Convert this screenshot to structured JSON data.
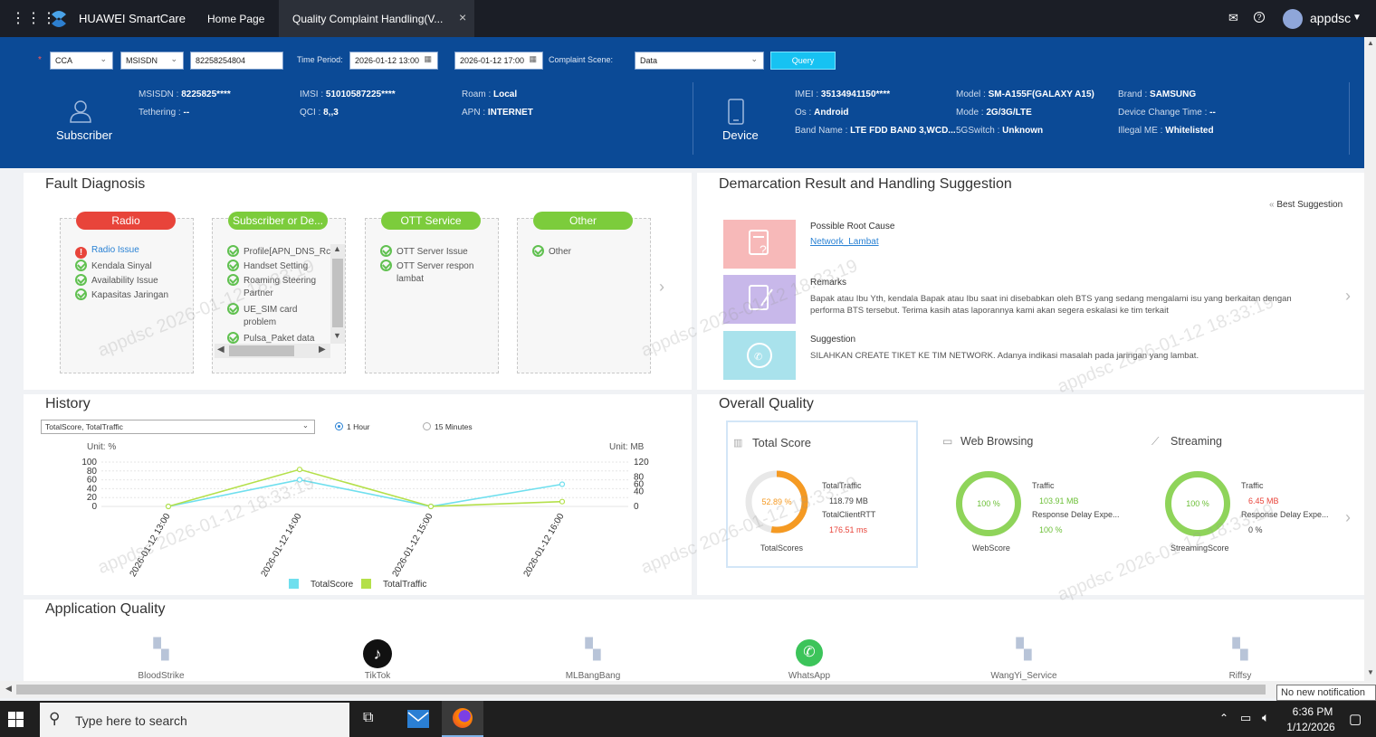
{
  "topbar": {
    "brand": "HUAWEI SmartCare",
    "tabs": [
      "Home Page",
      "Quality Complaint Handling(V..."
    ],
    "close": "×",
    "user": "appdsc"
  },
  "query": {
    "type": "CCA",
    "id_type": "MSISDN",
    "msisdn": "82258254804",
    "time_period_label": "Time Period:",
    "start": "2026-01-12 13:00",
    "end": "2026-01-12 17:00",
    "scene_label": "Complaint Scene:",
    "scene": "Data",
    "query_btn": "Query"
  },
  "subscriber": {
    "label": "Subscriber",
    "msisdn_k": "MSISDN",
    "msisdn_v": "8225825****",
    "imsi_k": "IMSI",
    "imsi_v": "51010587225****",
    "roam_k": "Roam",
    "roam_v": "Local",
    "tethering_k": "Tethering",
    "tethering_v": "--",
    "qci_k": "QCI",
    "qci_v": "8,,3",
    "apn_k": "APN",
    "apn_v": "INTERNET"
  },
  "device": {
    "label": "Device",
    "imei_k": "IMEI",
    "imei_v": "35134941150****",
    "model_k": "Model",
    "model_v": "SM-A155F(GALAXY A15)",
    "brand_k": "Brand",
    "brand_v": "SAMSUNG",
    "os_k": "Os",
    "os_v": "Android",
    "mode_k": "Mode",
    "mode_v": "2G/3G/LTE",
    "dct_k": "Device Change Time",
    "dct_v": "--",
    "band_k": "Band Name",
    "band_v": "LTE FDD BAND 3,WCD...",
    "sg_k": "5GSwitch",
    "sg_v": "Unknown",
    "ill_k": "Illegal ME",
    "ill_v": "Whitelisted"
  },
  "fault": {
    "title": "Fault Diagnosis",
    "columns": [
      {
        "name": "Radio",
        "color": "#e8443a",
        "items": [
          "Radio Issue",
          "Kendala Sinyal",
          "Availability Issue",
          "Kapasitas Jaringan"
        ]
      },
      {
        "name": "Subscriber or De...",
        "color": "#7ccc3c",
        "items": [
          "Profile[APN_DNS_Rc",
          "Handset Setting",
          "Roaming Steering",
          "Partner",
          "UE_SIM card",
          "problem",
          "Pulsa_Paket data"
        ]
      },
      {
        "name": "OTT Service",
        "color": "#7ccc3c",
        "items": [
          "OTT Server Issue",
          "OTT Server respon",
          "lambat"
        ]
      },
      {
        "name": "Other",
        "color": "#7ccc3c",
        "items": [
          "Other"
        ]
      }
    ]
  },
  "demarcation": {
    "title": "Demarcation Result and Handling Suggestion",
    "best": "Best Suggestion",
    "root_label": "Possible Root Cause",
    "root_link": "Network_Lambat",
    "remarks_label": "Remarks",
    "remarks_1": "Bapak atau Ibu Yth, kendala Bapak atau Ibu saat ini disebabkan oleh BTS yang sedang mengalami isu yang berkaitan dengan",
    "remarks_2": "performa BTS tersebut. Terima kasih atas laporannya kami akan segera eskalasi ke tim terkait",
    "sugg_label": "Suggestion",
    "sugg_text": "SILAHKAN CREATE TIKET KE TIM NETWORK. Adanya indikasi masalah pada jaringan yang lambat."
  },
  "history": {
    "title": "History",
    "select": "TotalScore, TotalTraffic",
    "radio1": "1 Hour",
    "radio2": "15 Minutes",
    "unit_left": "Unit: %",
    "unit_right": "Unit: MB"
  },
  "chart_data": {
    "type": "line",
    "x": [
      "2026-01-12 13:00",
      "2026-01-12 14:00",
      "2026-01-12 15:00",
      "2026-01-12 16:00"
    ],
    "series": [
      {
        "name": "TotalScore",
        "color": "#6fdfee",
        "axis": "left",
        "values": [
          0,
          60,
          0,
          50
        ]
      },
      {
        "name": "TotalTraffic",
        "color": "#b4e04a",
        "axis": "right",
        "values": [
          0,
          100,
          0,
          13
        ]
      }
    ],
    "yleft_ticks": [
      0,
      20,
      40,
      60,
      80,
      100
    ],
    "yright_ticks": [
      0,
      40,
      60,
      80,
      120
    ],
    "ylim_left": [
      0,
      100
    ],
    "ylim_right": [
      0,
      120
    ],
    "legend": "bottom"
  },
  "overall": {
    "title": "Overall Quality",
    "total_title": "Total Score",
    "total_pct": "52.89 %",
    "total_pct_num": 52.89,
    "total_traffic_k": "TotalTraffic",
    "total_traffic_v": "118.79 MB",
    "total_rtt_k": "TotalClientRTT",
    "total_rtt_v": "176.51 ms",
    "total_caption": "TotalScores",
    "web_title": "Web Browsing",
    "web_pct": "100 %",
    "web_traffic_k": "Traffic",
    "web_traffic_v": "103.91 MB",
    "web_delay_k": "Response Delay Expe...",
    "web_delay_v": "100 %",
    "web_caption": "WebScore",
    "stream_title": "Streaming",
    "stream_pct": "100 %",
    "stream_traffic_k": "Traffic",
    "stream_traffic_v": "6.45 MB",
    "stream_delay_k": "Response Delay Expe...",
    "stream_delay_v": "0 %",
    "stream_caption": "StreamingScore"
  },
  "apps": {
    "title": "Application Quality",
    "items": [
      "BloodStrike",
      "TikTok",
      "MLBangBang",
      "WhatsApp",
      "WangYi_Service",
      "Riffsy"
    ]
  },
  "watermarks": [
    "appdsc 2026-01-12 18:33:19"
  ],
  "notification": "No new notification",
  "taskbar": {
    "search": "Type here to search",
    "time": "6:36 PM",
    "date": "1/12/2026"
  }
}
